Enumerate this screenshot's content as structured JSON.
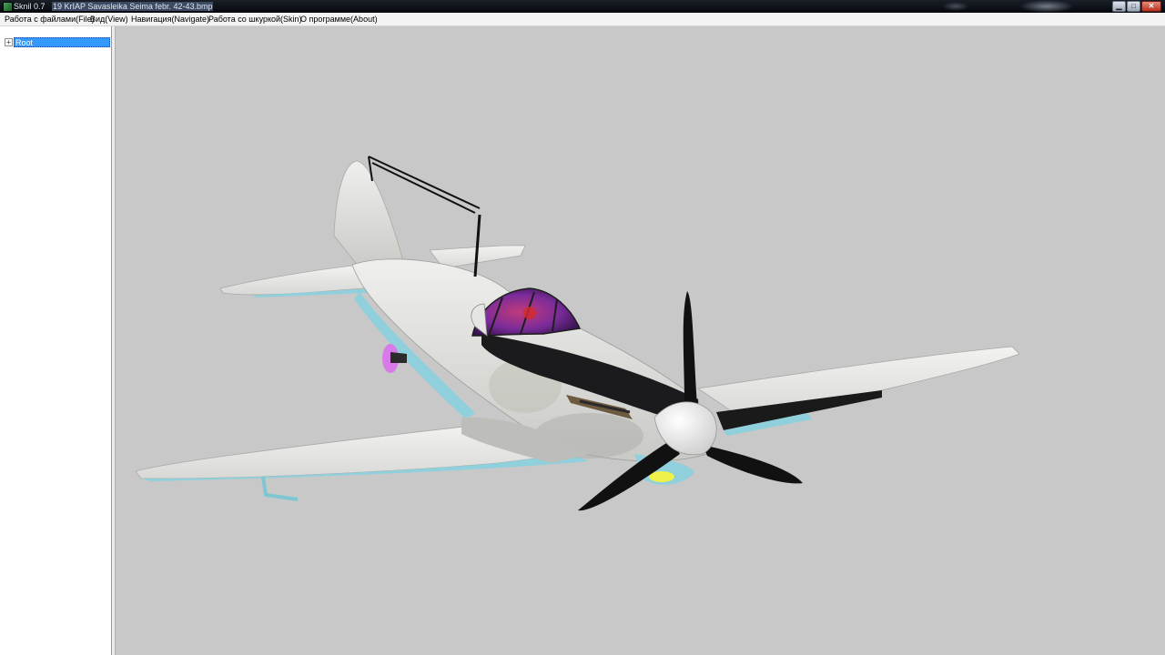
{
  "window": {
    "title_app": "Sknil 0.7",
    "title_file": "19 KrIAP Savasleika Seima febr. 42-43.bmp",
    "buttons": {
      "minimize": "▁",
      "maximize": "□",
      "close": "✕"
    }
  },
  "menu": {
    "items": [
      {
        "label": "Работа с файлами(File)"
      },
      {
        "label": "Вид(View)"
      },
      {
        "label": "Навигация(Navigate)"
      },
      {
        "label": "Работа со шкуркой(Skin)"
      },
      {
        "label": "О программе(About)"
      }
    ]
  },
  "tree": {
    "root_label": "Root",
    "expander": "+"
  },
  "colors": {
    "viewport_bg": "#c8c8c8",
    "selection": "#3399ff",
    "aircraft_body": "#e8e8e6",
    "aircraft_underside": "#8fd0dc",
    "propeller": "#111111",
    "cowling": "#1b1b1d"
  },
  "icons": {
    "app": "app-icon",
    "tree_expander": "plus-box-icon"
  }
}
